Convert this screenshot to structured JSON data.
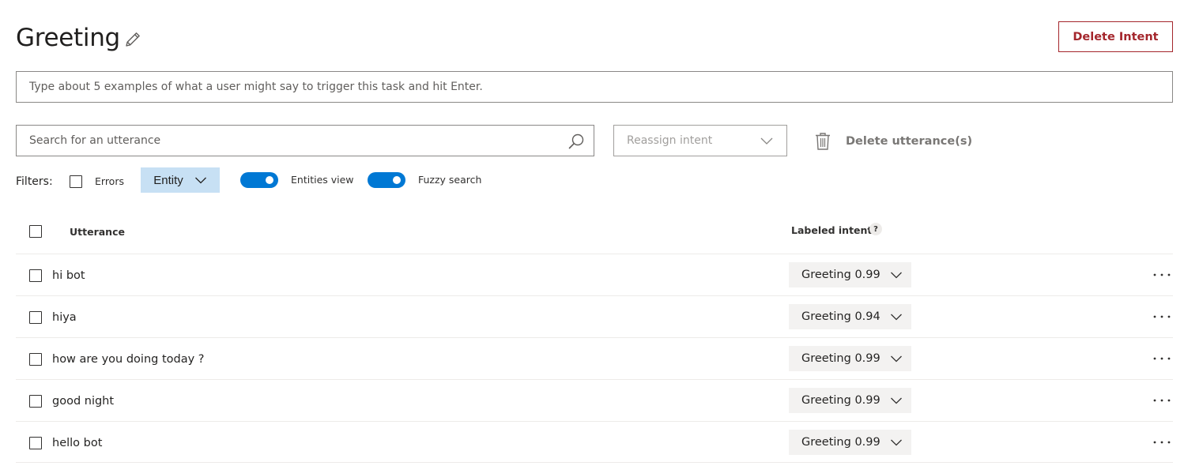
{
  "header": {
    "title": "Greeting",
    "delete_intent_label": "Delete Intent"
  },
  "example_input": {
    "placeholder": "Type about 5 examples of what a user might say to trigger this task and hit Enter."
  },
  "search": {
    "placeholder": "Search for an utterance"
  },
  "reassign": {
    "label": "Reassign intent"
  },
  "delete_utterances": {
    "label": "Delete utterance(s)"
  },
  "filters": {
    "label": "Filters:",
    "errors_label": "Errors",
    "errors_checked": false,
    "entity_label": "Entity",
    "entities_view_label": "Entities view",
    "entities_view_on": true,
    "fuzzy_search_label": "Fuzzy search",
    "fuzzy_search_on": true
  },
  "table": {
    "col_utterance": "Utterance",
    "col_labeled_intent": "Labeled intent",
    "help_badge": "?",
    "rows": [
      {
        "utterance": "hi bot",
        "intent": "Greeting 0.99"
      },
      {
        "utterance": "hiya",
        "intent": "Greeting 0.94"
      },
      {
        "utterance": "how are you doing today ?",
        "intent": "Greeting 0.99"
      },
      {
        "utterance": "good night",
        "intent": "Greeting 0.99"
      },
      {
        "utterance": "hello bot",
        "intent": "Greeting 0.99"
      }
    ]
  },
  "icons": {
    "edit": "pencil-icon",
    "search": "search-icon",
    "chevron": "chevron-down-icon",
    "trash": "trash-icon",
    "more": "more-horizontal-icon"
  },
  "colors": {
    "accent": "#0078d4",
    "danger": "#a4262c",
    "entity_button": "#c7e0f4"
  }
}
